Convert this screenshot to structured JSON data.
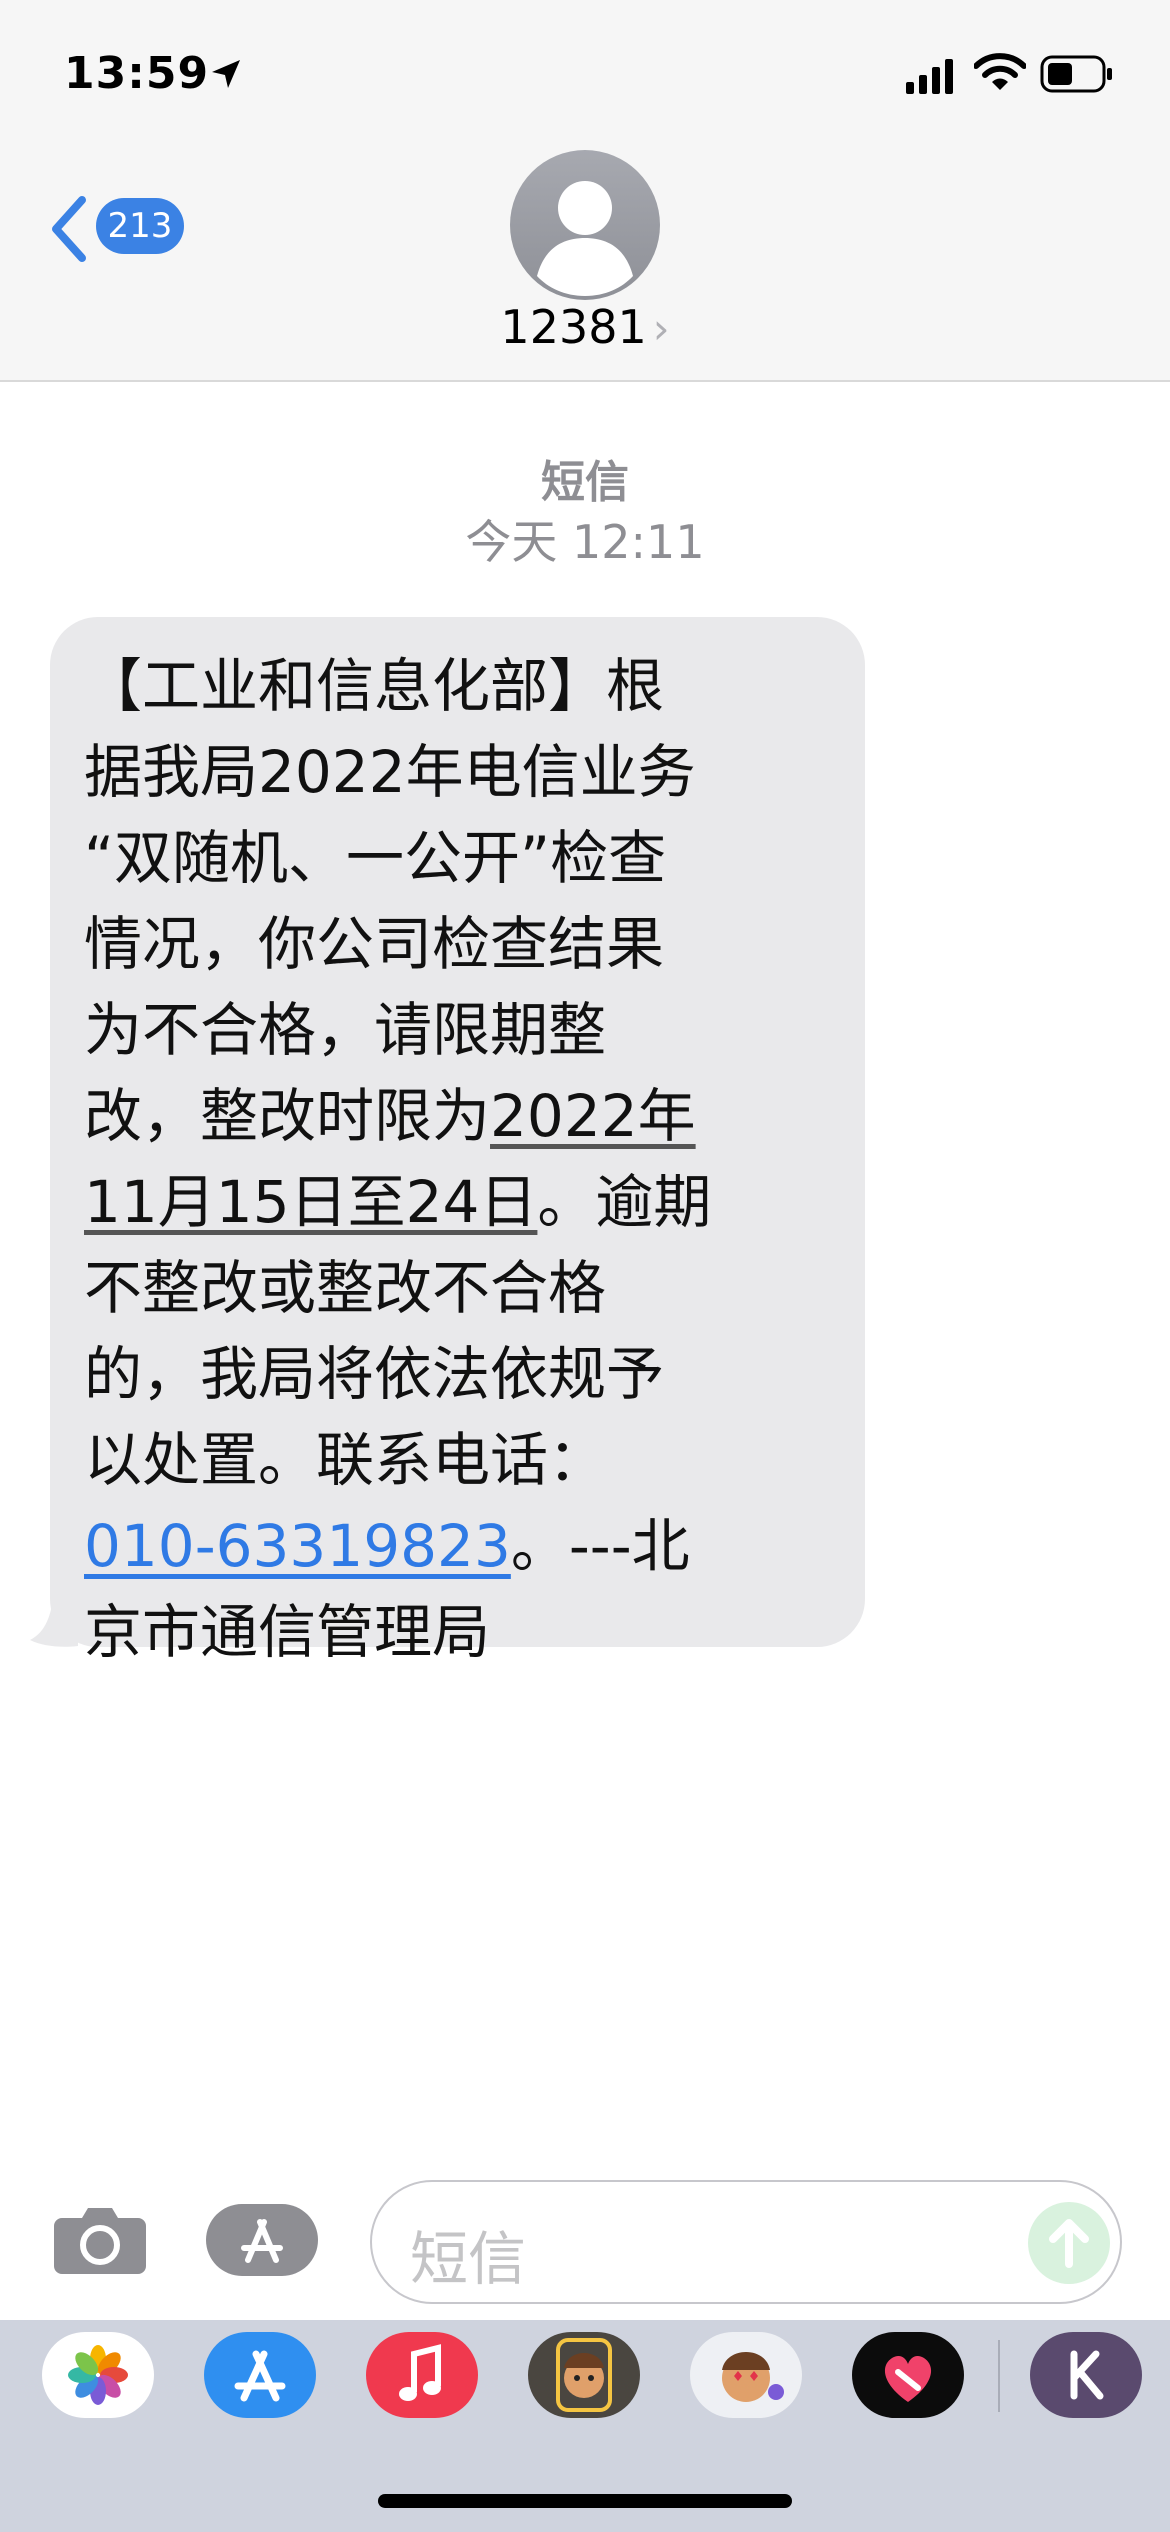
{
  "status_bar": {
    "time": "13:59"
  },
  "header": {
    "back_count": "213",
    "contact_name": "12381",
    "chevron": "›"
  },
  "conversation": {
    "label": "短信",
    "timestamp": "今天 12:11",
    "message": {
      "lines": [
        "【工业和信息化部】根",
        "据我局2022年电信业务",
        "“双随机、一公开”检查",
        "情况，你公司检查结果",
        "为不合格，请限期整",
        "改，整改时限为",
        "2022年",
        "11月15日至24日",
        "。逾期",
        "不整改或整改不合格",
        "的，我局将依法依规予",
        "以处置。联系电话：",
        "010-63319823",
        "。---北",
        "京市通信管理局"
      ]
    }
  },
  "input": {
    "placeholder": "短信"
  },
  "icons": {
    "status": [
      "location-icon",
      "signal-icon",
      "wifi-icon",
      "battery-icon"
    ],
    "drawer": [
      "photos-app-icon",
      "app-store-app-icon",
      "music-app-icon",
      "memoji-app-icon",
      "memoji-stickers-app-icon",
      "digital-touch-app-icon",
      "k-app-icon"
    ]
  },
  "colors": {
    "accent": "#3b82e4",
    "bubble": "#e9e9eb",
    "link": "#2f7ae5",
    "header_bg": "#f6f6f6"
  }
}
